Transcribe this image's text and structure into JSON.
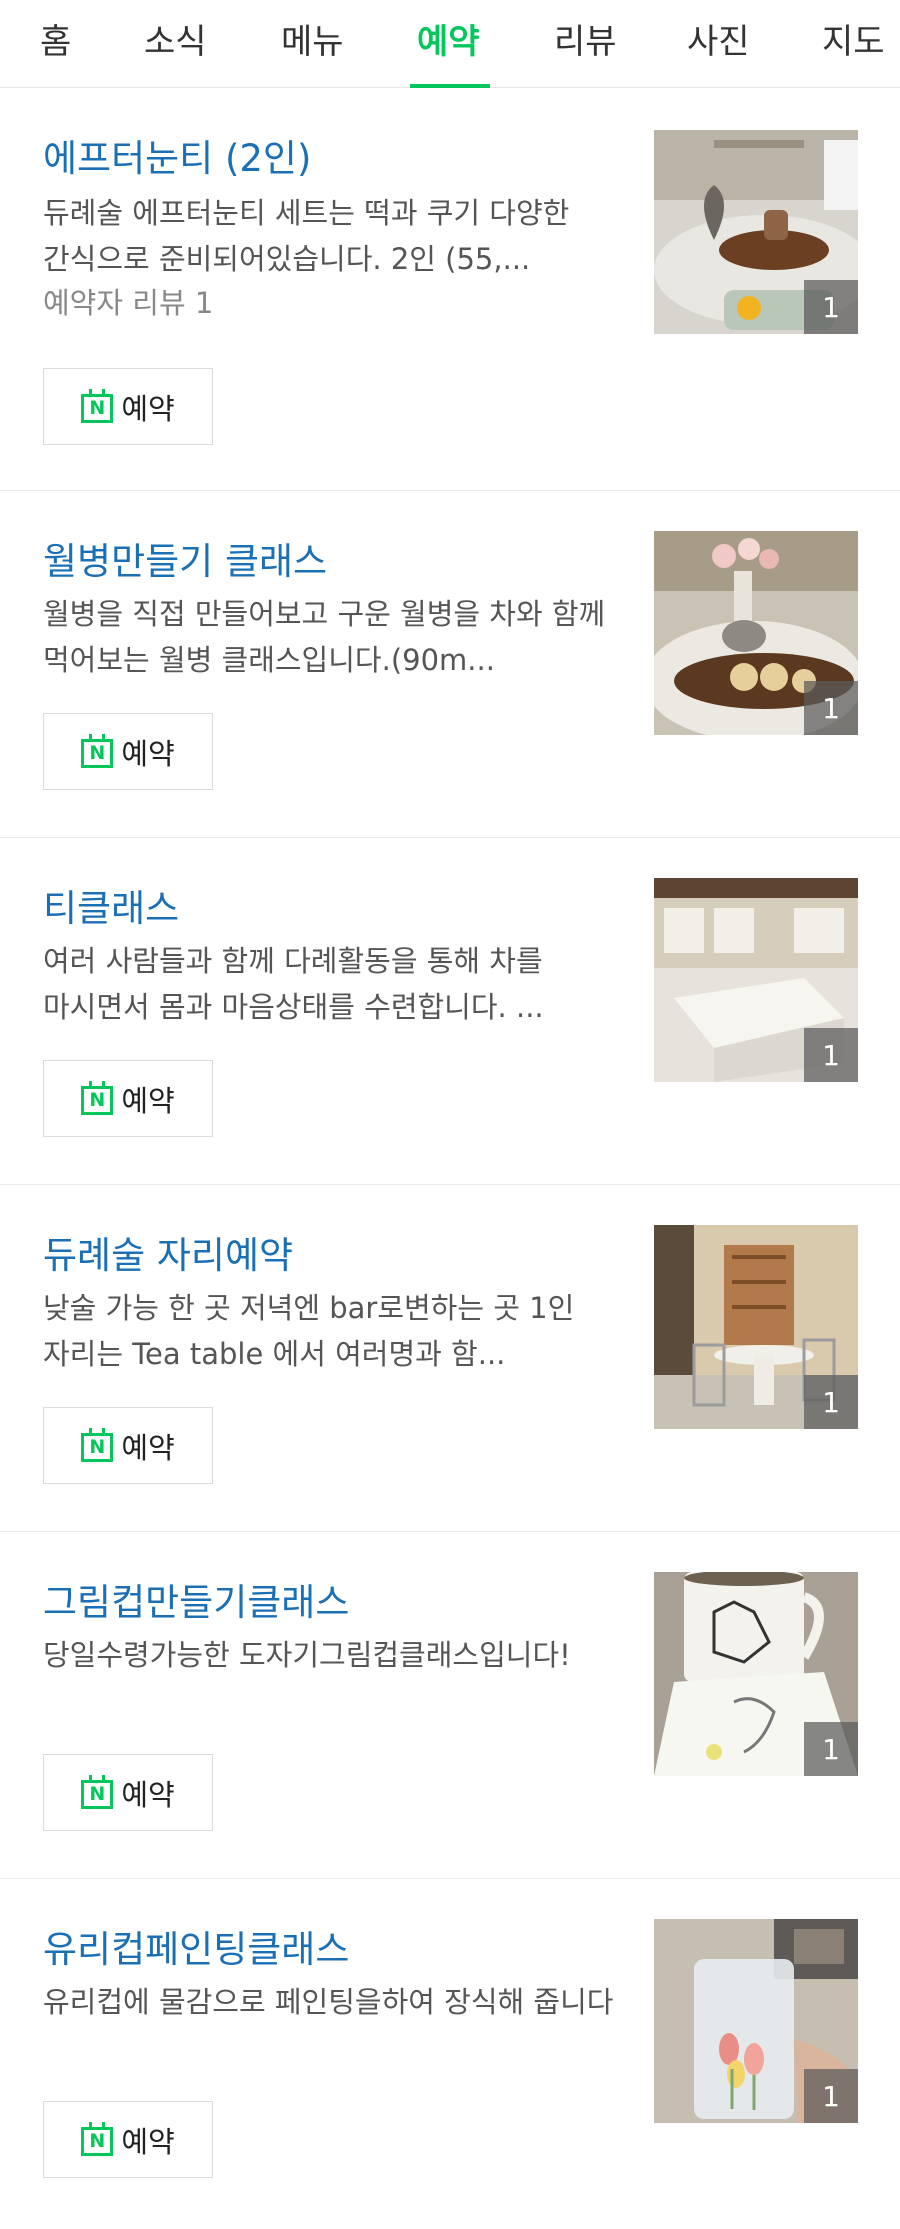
{
  "tabs": [
    {
      "label": "홈",
      "active": false
    },
    {
      "label": "소식",
      "active": false
    },
    {
      "label": "메뉴",
      "active": false
    },
    {
      "label": "예약",
      "active": true
    },
    {
      "label": "리뷰",
      "active": false
    },
    {
      "label": "사진",
      "active": false
    },
    {
      "label": "지도",
      "active": false
    }
  ],
  "accent_color": "#03c75a",
  "title_color": "#1a6fb5",
  "items": [
    {
      "title": "에프터눈티 (2인)",
      "desc": "듀례술 에프터눈티 세트는 떡과 쿠기 다양한 간식으로 준비되어있습니다. 2인 (55,...",
      "review": "예약자 리뷰 1",
      "button": "예약",
      "photo_count": "1"
    },
    {
      "title": "월병만들기 클래스",
      "desc": "월병을 직접 만들어보고 구운 월병을 차와 함께 먹어보는 월병 클래스입니다.(90m...",
      "button": "예약",
      "photo_count": "1"
    },
    {
      "title": "티클래스",
      "desc": "여러 사람들과 함께 다례활동을 통해 차를 마시면서 몸과 마음상태를 수련합니다. ...",
      "button": "예약",
      "photo_count": "1"
    },
    {
      "title": "듀례술 자리예약",
      "desc": "낮술 가능 한 곳 저녁엔 bar로변하는 곳 1인 자리는 Tea table 에서 여러명과 함...",
      "button": "예약",
      "photo_count": "1"
    },
    {
      "title": "그림컵만들기클래스",
      "desc": "당일수령가능한 도자기그림컵클래스입니다!",
      "button": "예약",
      "photo_count": "1"
    },
    {
      "title": "유리컵페인팅클래스",
      "desc": "유리컵에 물감으로 페인팅을하여 장식해 줍니다",
      "button": "예약",
      "photo_count": "1"
    }
  ]
}
